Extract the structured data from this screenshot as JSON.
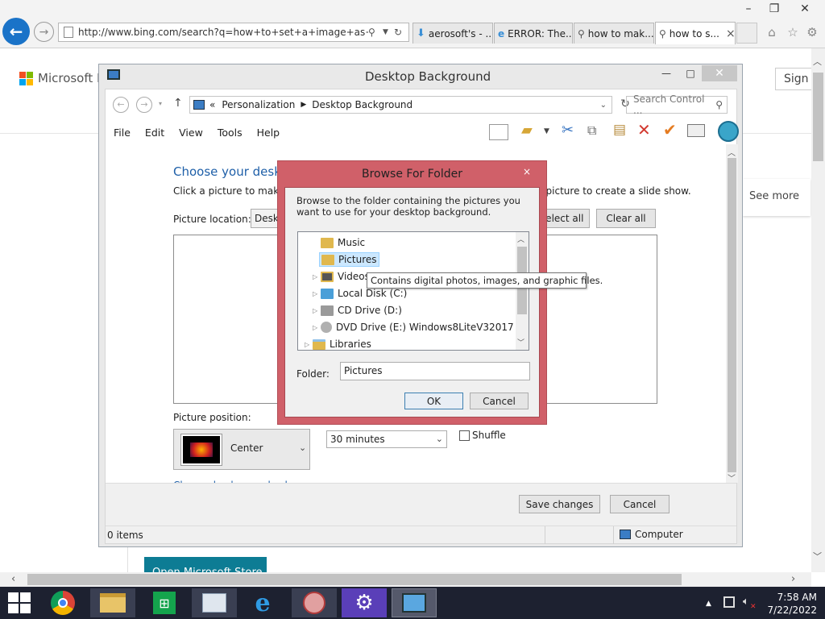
{
  "browser": {
    "address": "http://www.bing.com/search?q=how+to+set+a+image+as+wallpa",
    "tabs": [
      {
        "label": "aerosoft's - ..."
      },
      {
        "label": "ERROR: The..."
      },
      {
        "label": "how to mak..."
      },
      {
        "label": "how to s...",
        "close": "×"
      }
    ]
  },
  "page": {
    "logo_text": "Microsoft Bi",
    "signin": "Sign i",
    "see_more": "See more",
    "store_button": "Open Microsoft Store"
  },
  "desktop_background": {
    "title": "Desktop Background",
    "breadcrumb": {
      "prefix": "«",
      "items": [
        "Personalization",
        "Desktop Background"
      ]
    },
    "search_placeholder": "Search Control ...",
    "menu": [
      "File",
      "Edit",
      "View",
      "Tools",
      "Help"
    ],
    "heading": "Choose your desktop background",
    "subtitle": "Click a picture to make it your desktop background, or select more than one picture to create a slide show.",
    "picture_location_label": "Picture location:",
    "picture_location_value": "Desktop",
    "select_all": "Select all",
    "clear_all": "Clear all",
    "picture_position_label": "Picture position:",
    "position_value": "Center",
    "interval_value": "30 minutes",
    "shuffle_label": "Shuffle",
    "change_bg_color": "Change background color",
    "save_changes": "Save changes",
    "cancel": "Cancel",
    "status_items": "0 items",
    "status_location": "Computer"
  },
  "browse_dialog": {
    "title": "Browse For Folder",
    "close": "×",
    "description": "Browse to the folder containing the pictures you want to use for your desktop background.",
    "tree": [
      {
        "label": "Music",
        "indent": 2,
        "expander": "",
        "icon": "music-folder-icon",
        "selected": false
      },
      {
        "label": "Pictures",
        "indent": 2,
        "expander": "",
        "icon": "pictures-folder-icon",
        "selected": true
      },
      {
        "label": "Videos",
        "indent": 2,
        "expander": "▷",
        "icon": "videos-folder-icon",
        "selected": false
      },
      {
        "label": "Local Disk (C:)",
        "indent": 2,
        "expander": "▷",
        "icon": "local-disk-icon",
        "selected": false
      },
      {
        "label": "CD Drive (D:)",
        "indent": 2,
        "expander": "▷",
        "icon": "cd-drive-icon",
        "selected": false
      },
      {
        "label": "DVD Drive (E:) Windows8LiteV32017",
        "indent": 2,
        "expander": "▷",
        "icon": "dvd-drive-icon",
        "selected": false
      },
      {
        "label": "Libraries",
        "indent": 1,
        "expander": "▷",
        "icon": "libraries-icon",
        "selected": false
      }
    ],
    "tooltip": "Contains digital photos, images, and graphic files.",
    "folder_label": "Folder:",
    "folder_value": "Pictures",
    "ok": "OK",
    "cancel": "Cancel"
  },
  "taskbar": {
    "time": "7:58 AM",
    "date": "7/22/2022",
    "apps": [
      "chrome-icon",
      "file-explorer-icon",
      "store-icon",
      "performance-monitor-icon",
      "internet-explorer-icon",
      "snipping-tool-icon",
      "settings-icon",
      "control-panel-icon"
    ]
  },
  "colors": {
    "accent": "#1a73c8",
    "dialog_border": "#d06069",
    "link": "#1e5fa8",
    "taskbar": "#1d2130"
  }
}
